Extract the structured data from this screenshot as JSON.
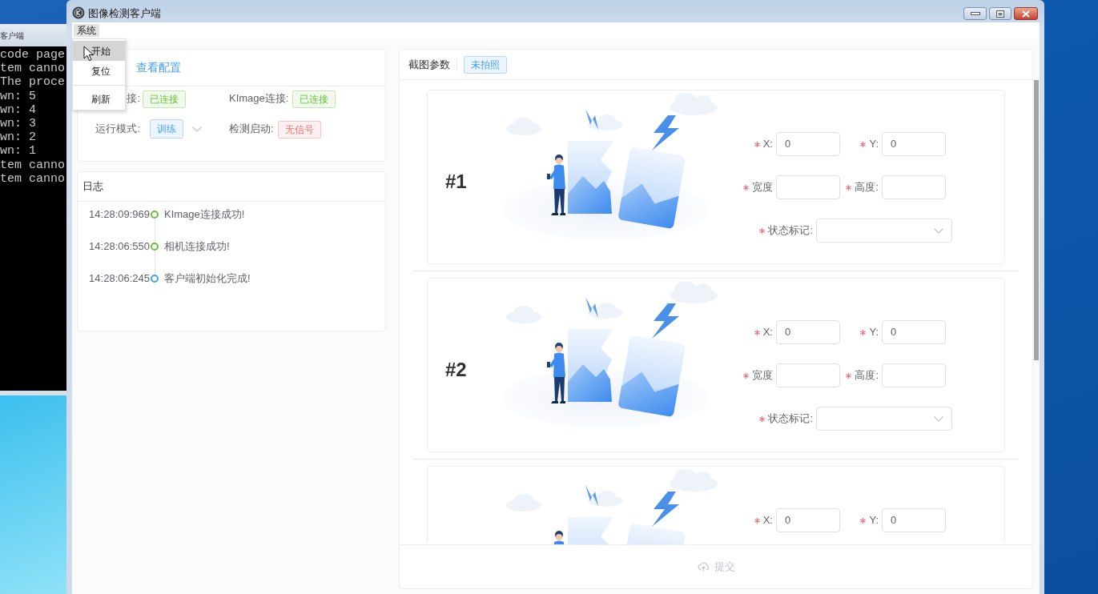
{
  "desktop": {
    "console_window": {
      "title": "客户端",
      "lines": [
        "code page",
        "tem canno",
        "The proce",
        "wn: 5",
        "wn: 4",
        "wn: 3",
        "wn: 2",
        "wn: 1",
        "tem canno",
        "tem canno"
      ]
    }
  },
  "window": {
    "title": "图像检测客户端",
    "menu_bar": [
      {
        "label": "系统",
        "selected": true
      }
    ],
    "menu_dropdown": [
      {
        "kind": "item",
        "label": "开始",
        "selected": true
      },
      {
        "kind": "item",
        "label": "复位",
        "selected": false
      },
      {
        "kind": "separator"
      },
      {
        "kind": "item",
        "label": "刷新",
        "selected": false
      }
    ]
  },
  "status_panel": {
    "link": "查看配置",
    "fields": [
      {
        "kind": "tag",
        "label": "接:",
        "value": "已连接",
        "color": "#67c23a"
      },
      {
        "kind": "tag",
        "label": "KImage连接:",
        "value": "已连接",
        "color": "#67c23a"
      },
      {
        "kind": "select",
        "label": "运行模式:",
        "value": "训练"
      },
      {
        "kind": "tag",
        "label": "检测启动:",
        "value": "无信号",
        "color": "#f56c6c"
      }
    ]
  },
  "log_panel": {
    "title": "日志",
    "entries": [
      {
        "time": "14:28:09:969",
        "message": "KImage连接成功!",
        "color": "#67c23a"
      },
      {
        "time": "14:28:06:550",
        "message": "相机连接成功!",
        "color": "#67c23a"
      },
      {
        "time": "14:28:06:245",
        "message": "客户端初始化完成!",
        "color": "#409eff"
      }
    ]
  },
  "capture_panel": {
    "title": "截图参数",
    "status_tag": {
      "label": "未拍照",
      "color": "#409eff"
    },
    "cards": [
      {
        "label": "#1",
        "rows": [
          [
            {
              "kind": "input",
              "label": "X:",
              "value": "0",
              "required": true
            },
            {
              "kind": "input",
              "label": "Y:",
              "value": "0",
              "required": true
            }
          ],
          [
            {
              "kind": "input",
              "label": "宽度",
              "required": true
            },
            {
              "kind": "input",
              "label": "高度:",
              "required": true
            }
          ],
          [
            {
              "kind": "select",
              "label": "状态标记:",
              "required": true
            }
          ]
        ]
      },
      {
        "label": "#2",
        "rows": [
          [
            {
              "kind": "input",
              "label": "X:",
              "value": "0",
              "required": true
            },
            {
              "kind": "input",
              "label": "Y:",
              "value": "0",
              "required": true
            }
          ],
          [
            {
              "kind": "input",
              "label": "宽度",
              "required": true
            },
            {
              "kind": "input",
              "label": "高度:",
              "required": true
            }
          ],
          [
            {
              "kind": "select",
              "label": "状态标记:",
              "required": true
            }
          ]
        ]
      },
      {
        "rows": [
          [
            {
              "kind": "input",
              "label": "X:",
              "value": "0",
              "required": true
            },
            {
              "kind": "input",
              "label": "Y:",
              "value": "0",
              "required": true
            }
          ]
        ]
      }
    ],
    "submit": {
      "label": "提交",
      "disabled": true
    }
  }
}
